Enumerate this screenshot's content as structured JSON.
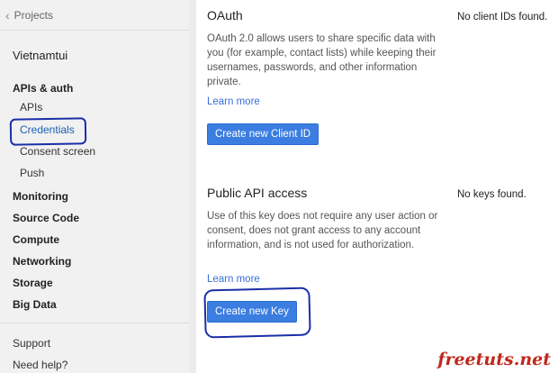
{
  "nav": {
    "back_label": "Projects"
  },
  "project": {
    "name": "Vietnamtui"
  },
  "sidebar": {
    "groups": {
      "apis_auth": "APIs & auth",
      "apis": "APIs",
      "credentials": "Credentials",
      "consent_screen": "Consent screen",
      "push": "Push",
      "monitoring": "Monitoring",
      "source_code": "Source Code",
      "compute": "Compute",
      "networking": "Networking",
      "storage": "Storage",
      "big_data": "Big Data"
    },
    "support": "Support",
    "need_help": "Need help?"
  },
  "oauth": {
    "title": "OAuth",
    "description": "OAuth 2.0 allows users to share specific data with you (for example, contact lists) while keeping their usernames, passwords, and other information private.",
    "learn_more": "Learn more",
    "button": "Create new Client ID",
    "status": "No client IDs found."
  },
  "public_api": {
    "title": "Public API access",
    "description": "Use of this key does not require any user action or consent, does not grant access to any account information, and is not used for authorization.",
    "learn_more": "Learn more",
    "button": "Create new Key",
    "status": "No keys found."
  },
  "watermark": "freetuts.net",
  "colors": {
    "accent": "#3b7de0",
    "link": "#3a6fd8",
    "active_nav": "#1a5fb4",
    "annotation": "#1a2ea8",
    "watermark": "#c0271d"
  }
}
